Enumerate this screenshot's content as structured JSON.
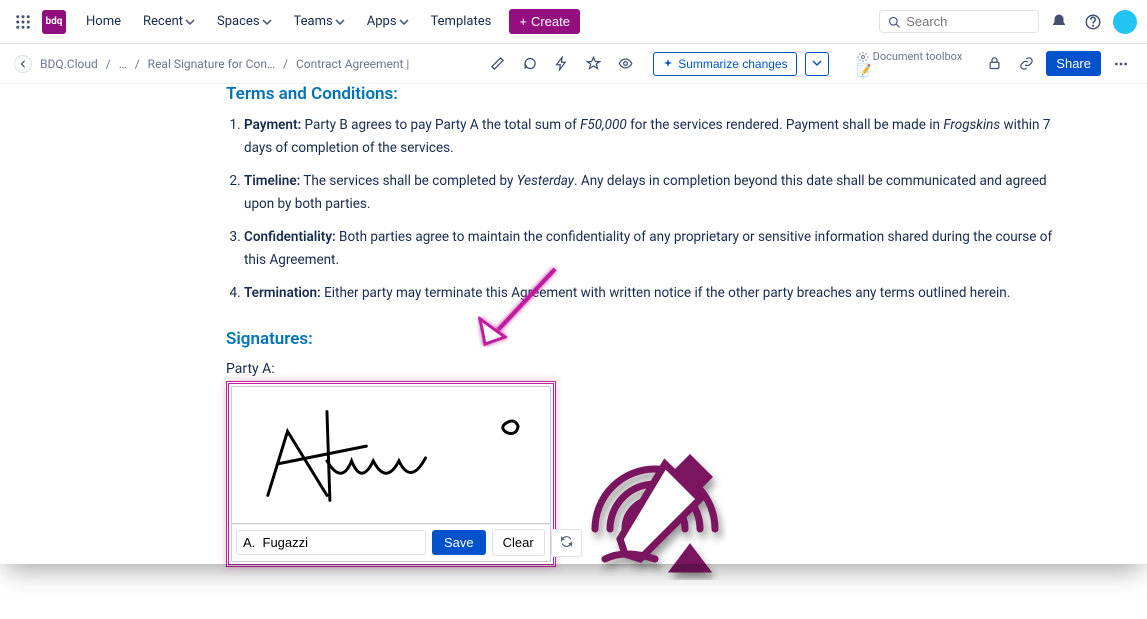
{
  "nav": {
    "logo_text": "bdq",
    "home": "Home",
    "recent": "Recent",
    "spaces": "Spaces",
    "teams": "Teams",
    "apps": "Apps",
    "templates": "Templates",
    "create": "Create",
    "search_placeholder": "Search"
  },
  "breadcrumb": {
    "space": "BDQ.Cloud",
    "ellipsis": "…",
    "page1": "Real Signature for Con…",
    "page2": "Contract Agreement |"
  },
  "page_tools": {
    "summarize": "Summarize changes",
    "doc_toolbox": "Document toolbox",
    "share": "Share"
  },
  "document": {
    "terms_heading": "Terms and Conditions:",
    "items": [
      {
        "label": "Payment:",
        "text_a": " Party B agrees to pay Party A the total sum of ",
        "amount": "F50,000",
        "text_b": " for the services rendered. Payment shall be made in ",
        "currency": "Frogskins",
        "text_c": " within 7 days of completion of the services."
      },
      {
        "label": "Timeline:",
        "text_a": " The services shall be completed by ",
        "deadline": "Yesterday",
        "text_b": ". Any delays in completion beyond this date shall be communicated and agreed upon by both parties."
      },
      {
        "label": "Confidentiality:",
        "text": " Both parties agree to maintain the confidentiality of any proprietary or sensitive information shared during the course of this Agreement."
      },
      {
        "label": "Termination:",
        "text": " Either party may terminate this Agreement with written notice if the other party breaches any terms outlined herein."
      }
    ],
    "sig_heading": "Signatures:",
    "party_a_label": "Party A:",
    "signer_name": "A.  Fugazzi",
    "save": "Save",
    "clear": "Clear"
  }
}
